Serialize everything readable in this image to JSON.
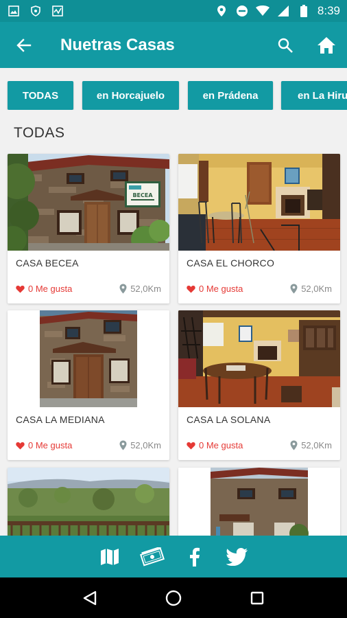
{
  "status_bar": {
    "time": "8:39"
  },
  "app_bar": {
    "title": "Nuetras Casas"
  },
  "filters": [
    {
      "label": "TODAS"
    },
    {
      "label": "en Horcajuelo"
    },
    {
      "label": "en Prádena"
    },
    {
      "label": "en La Hiru"
    }
  ],
  "section": {
    "title": "TODAS"
  },
  "houses": [
    {
      "name": "CASA BECEA",
      "likes": "0 Me gusta",
      "distance": "52,0Km",
      "sign": "BECEA"
    },
    {
      "name": "CASA EL CHORCO",
      "likes": "0 Me gusta",
      "distance": "52,0Km"
    },
    {
      "name": "CASA LA MEDIANA",
      "likes": "0 Me gusta",
      "distance": "52,0Km"
    },
    {
      "name": "CASA LA SOLANA",
      "likes": "0 Me gusta",
      "distance": "52,0Km"
    },
    {
      "name": "",
      "likes": "",
      "distance": ""
    },
    {
      "name": "",
      "likes": "",
      "distance": ""
    }
  ],
  "colors": {
    "primary": "#129aa3",
    "status": "#0f8f96",
    "like": "#e53935"
  }
}
